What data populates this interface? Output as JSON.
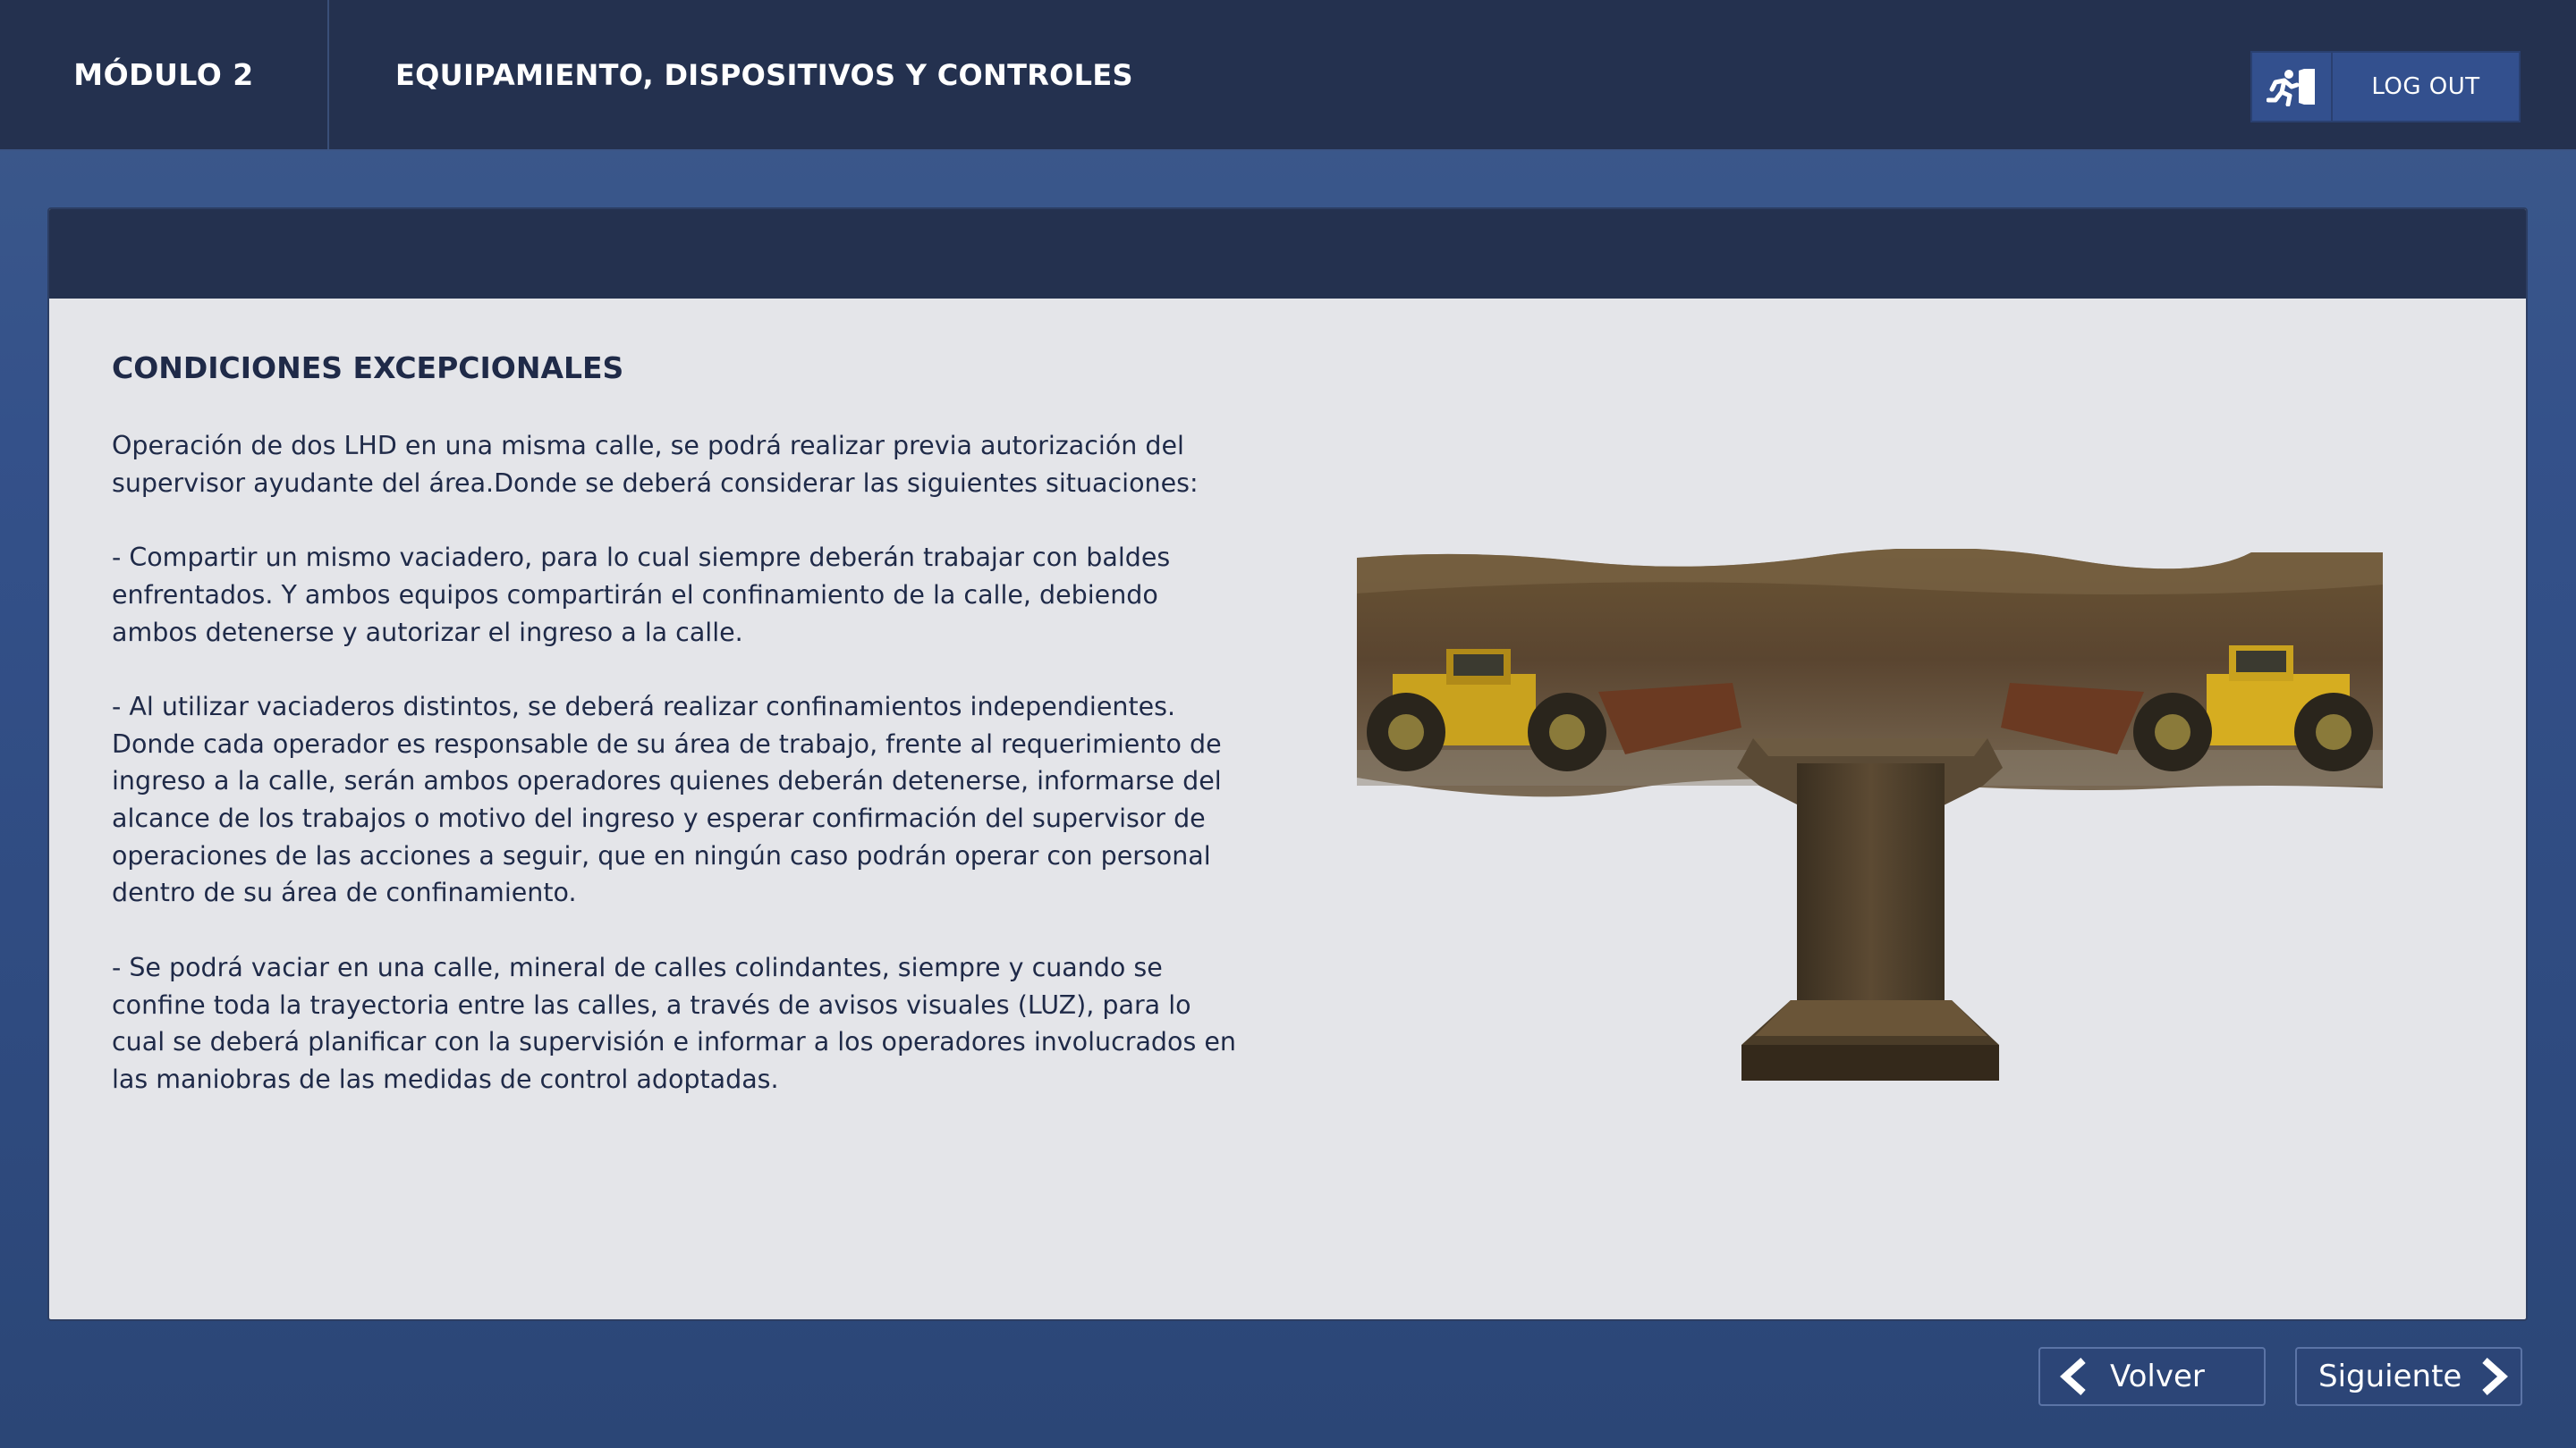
{
  "header": {
    "module_label": "MÓDULO 2",
    "section_title": "EQUIPAMIENTO, DISPOSITIVOS Y CONTROLES",
    "logout_label": "LOG OUT",
    "logout_icon": "exit-running-icon"
  },
  "content": {
    "title": "CONDICIONES EXCEPCIONALES",
    "paragraphs": [
      "Operación de dos LHD en una misma calle, se podrá realizar previa autorización del supervisor ayudante del área.Donde se deberá considerar las siguientes situaciones:",
      "- Compartir un mismo vaciadero, para lo cual siempre deberán trabajar con baldes enfrentados. Y ambos equipos compartirán el confinamiento de la calle, debiendo ambos detenerse y autorizar el ingreso a la calle.",
      "- Al utilizar vaciaderos distintos, se deberá realizar confinamientos independientes. Donde cada operador es responsable de su área de trabajo, frente al requerimiento de ingreso a la calle, serán ambos operadores quienes deberán detenerse, informarse del alcance de los trabajos o motivo del ingreso y esperar confirmación del supervisor de operaciones de las acciones a seguir, que en ningún caso podrán operar con personal dentro de su área de confinamiento.",
      "- Se podrá vaciar en una calle, mineral de calles colindantes, siempre y cuando se confine toda la trayectoria entre las calles, a través de avisos visuales (LUZ), para lo cual se deberá planificar con la supervisión e informar a los operadores involucrados en las maniobras de las medidas de control adoptadas."
    ]
  },
  "navigation": {
    "back_label": "Volver",
    "next_label": "Siguiente"
  },
  "colors": {
    "header_bg": "#24314f",
    "page_bg": "#34518a",
    "panel_bg": "#e4e5e9",
    "text": "#1f2a48",
    "button_bg": "#2c4577"
  }
}
